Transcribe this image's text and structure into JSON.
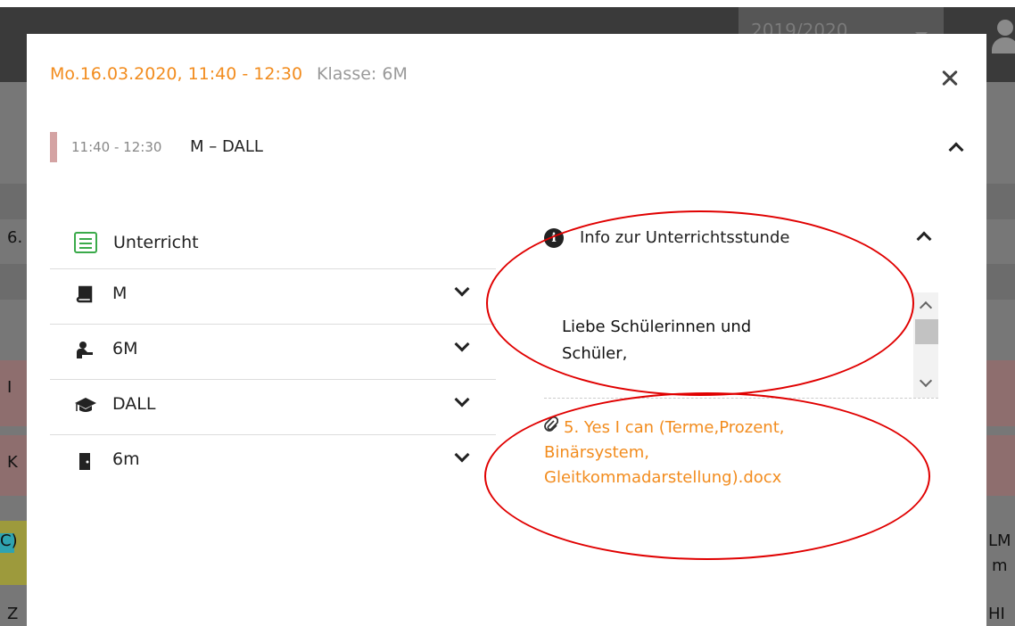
{
  "background": {
    "year_selector": "2019/2020",
    "left_labels": [
      "6.",
      "I",
      "K",
      "C)"
    ],
    "right_labels": [
      "LM",
      "m",
      "HI"
    ],
    "bottom_left": "Z"
  },
  "modal": {
    "date_time": "Mo.16.03.2020, 11:40 - 12:30",
    "class_label": "Klasse: 6M",
    "lesson": {
      "time": "11:40 - 12:30",
      "subject": "M – DALL"
    },
    "unterricht_label": "Unterricht",
    "rows": [
      {
        "label": "M",
        "icon": "book-icon"
      },
      {
        "label": "6M",
        "icon": "student-icon"
      },
      {
        "label": "DALL",
        "icon": "graduation-cap-icon"
      },
      {
        "label": "6m",
        "icon": "door-icon"
      }
    ],
    "info": {
      "title": "Info zur Unterrichtsstunde",
      "message": "Liebe Schülerinnen und Schüler,"
    },
    "attachment": "5. Yes I can (Terme,Prozent, Binärsystem, Gleitkommadarstellung).docx"
  },
  "colors": {
    "accent_orange": "#f28c1e",
    "lesson_bar": "#d4a3a3",
    "annotation_red": "#e00000",
    "unterricht_green": "#3aaa4a"
  }
}
